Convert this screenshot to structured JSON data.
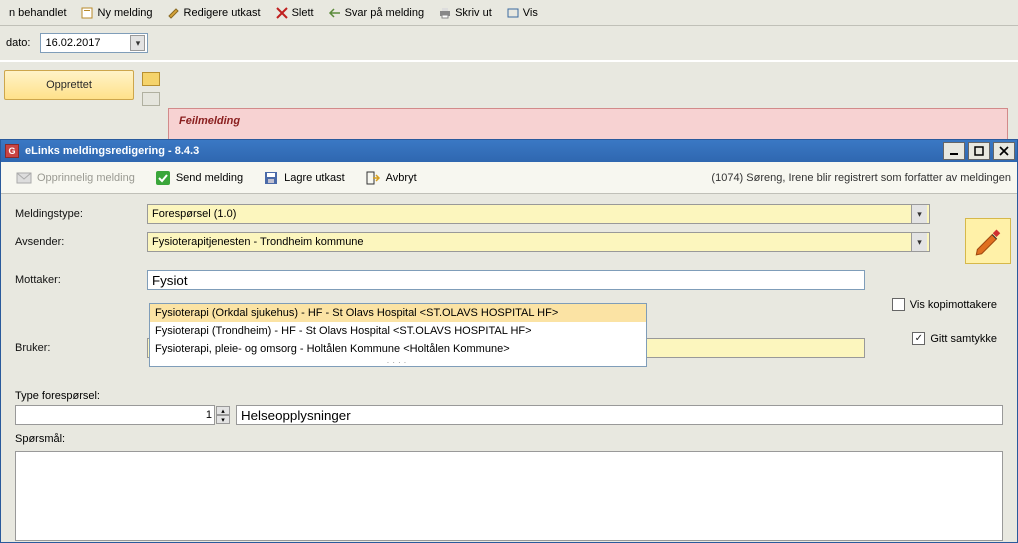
{
  "toolbar": {
    "behandlet": "n behandlet",
    "ny_melding": "Ny melding",
    "redigere_utkast": "Redigere utkast",
    "slett": "Slett",
    "svar": "Svar på melding",
    "skriv_ut": "Skriv ut",
    "vis": "Vis"
  },
  "date_row": {
    "label": "dato:",
    "value": "16.02.2017"
  },
  "badge": {
    "opprettet": "Opprettet"
  },
  "feilmelding": "Feilmelding",
  "window": {
    "title": "eLinks meldingsredigering - 8.4.3"
  },
  "mtoolbar": {
    "opprinnelig": "Opprinnelig melding",
    "send": "Send melding",
    "lagre": "Lagre utkast",
    "avbryt": "Avbryt",
    "status": "(1074) Søreng, Irene blir registrert som forfatter av meldingen"
  },
  "form": {
    "meldingstype_label": "Meldingstype:",
    "meldingstype_value": "Forespørsel (1.0)",
    "avsender_label": "Avsender:",
    "avsender_value": "Fysioterapitjenesten - Trondheim kommune",
    "mottaker_label": "Mottaker:",
    "mottaker_value": "Fysiot",
    "bruker_label": "Bruker:",
    "vis_kopimottakere": "Vis kopimottakere",
    "gitt_samtykke": "Gitt samtykke"
  },
  "autocomplete": {
    "items": [
      "Fysioterapi (Orkdal sjukehus) - HF - St Olavs Hospital <ST.OLAVS HOSPITAL HF>",
      "Fysioterapi (Trondheim) - HF - St Olavs Hospital <ST.OLAVS HOSPITAL HF>",
      "Fysioterapi, pleie- og omsorg - Holtålen Kommune <Holtålen Kommune>"
    ]
  },
  "lower": {
    "type_label": "Type forespørsel:",
    "num_value": "1",
    "helse_value": "Helseopplysninger",
    "sporsmal_label": "Spørsmål:"
  }
}
